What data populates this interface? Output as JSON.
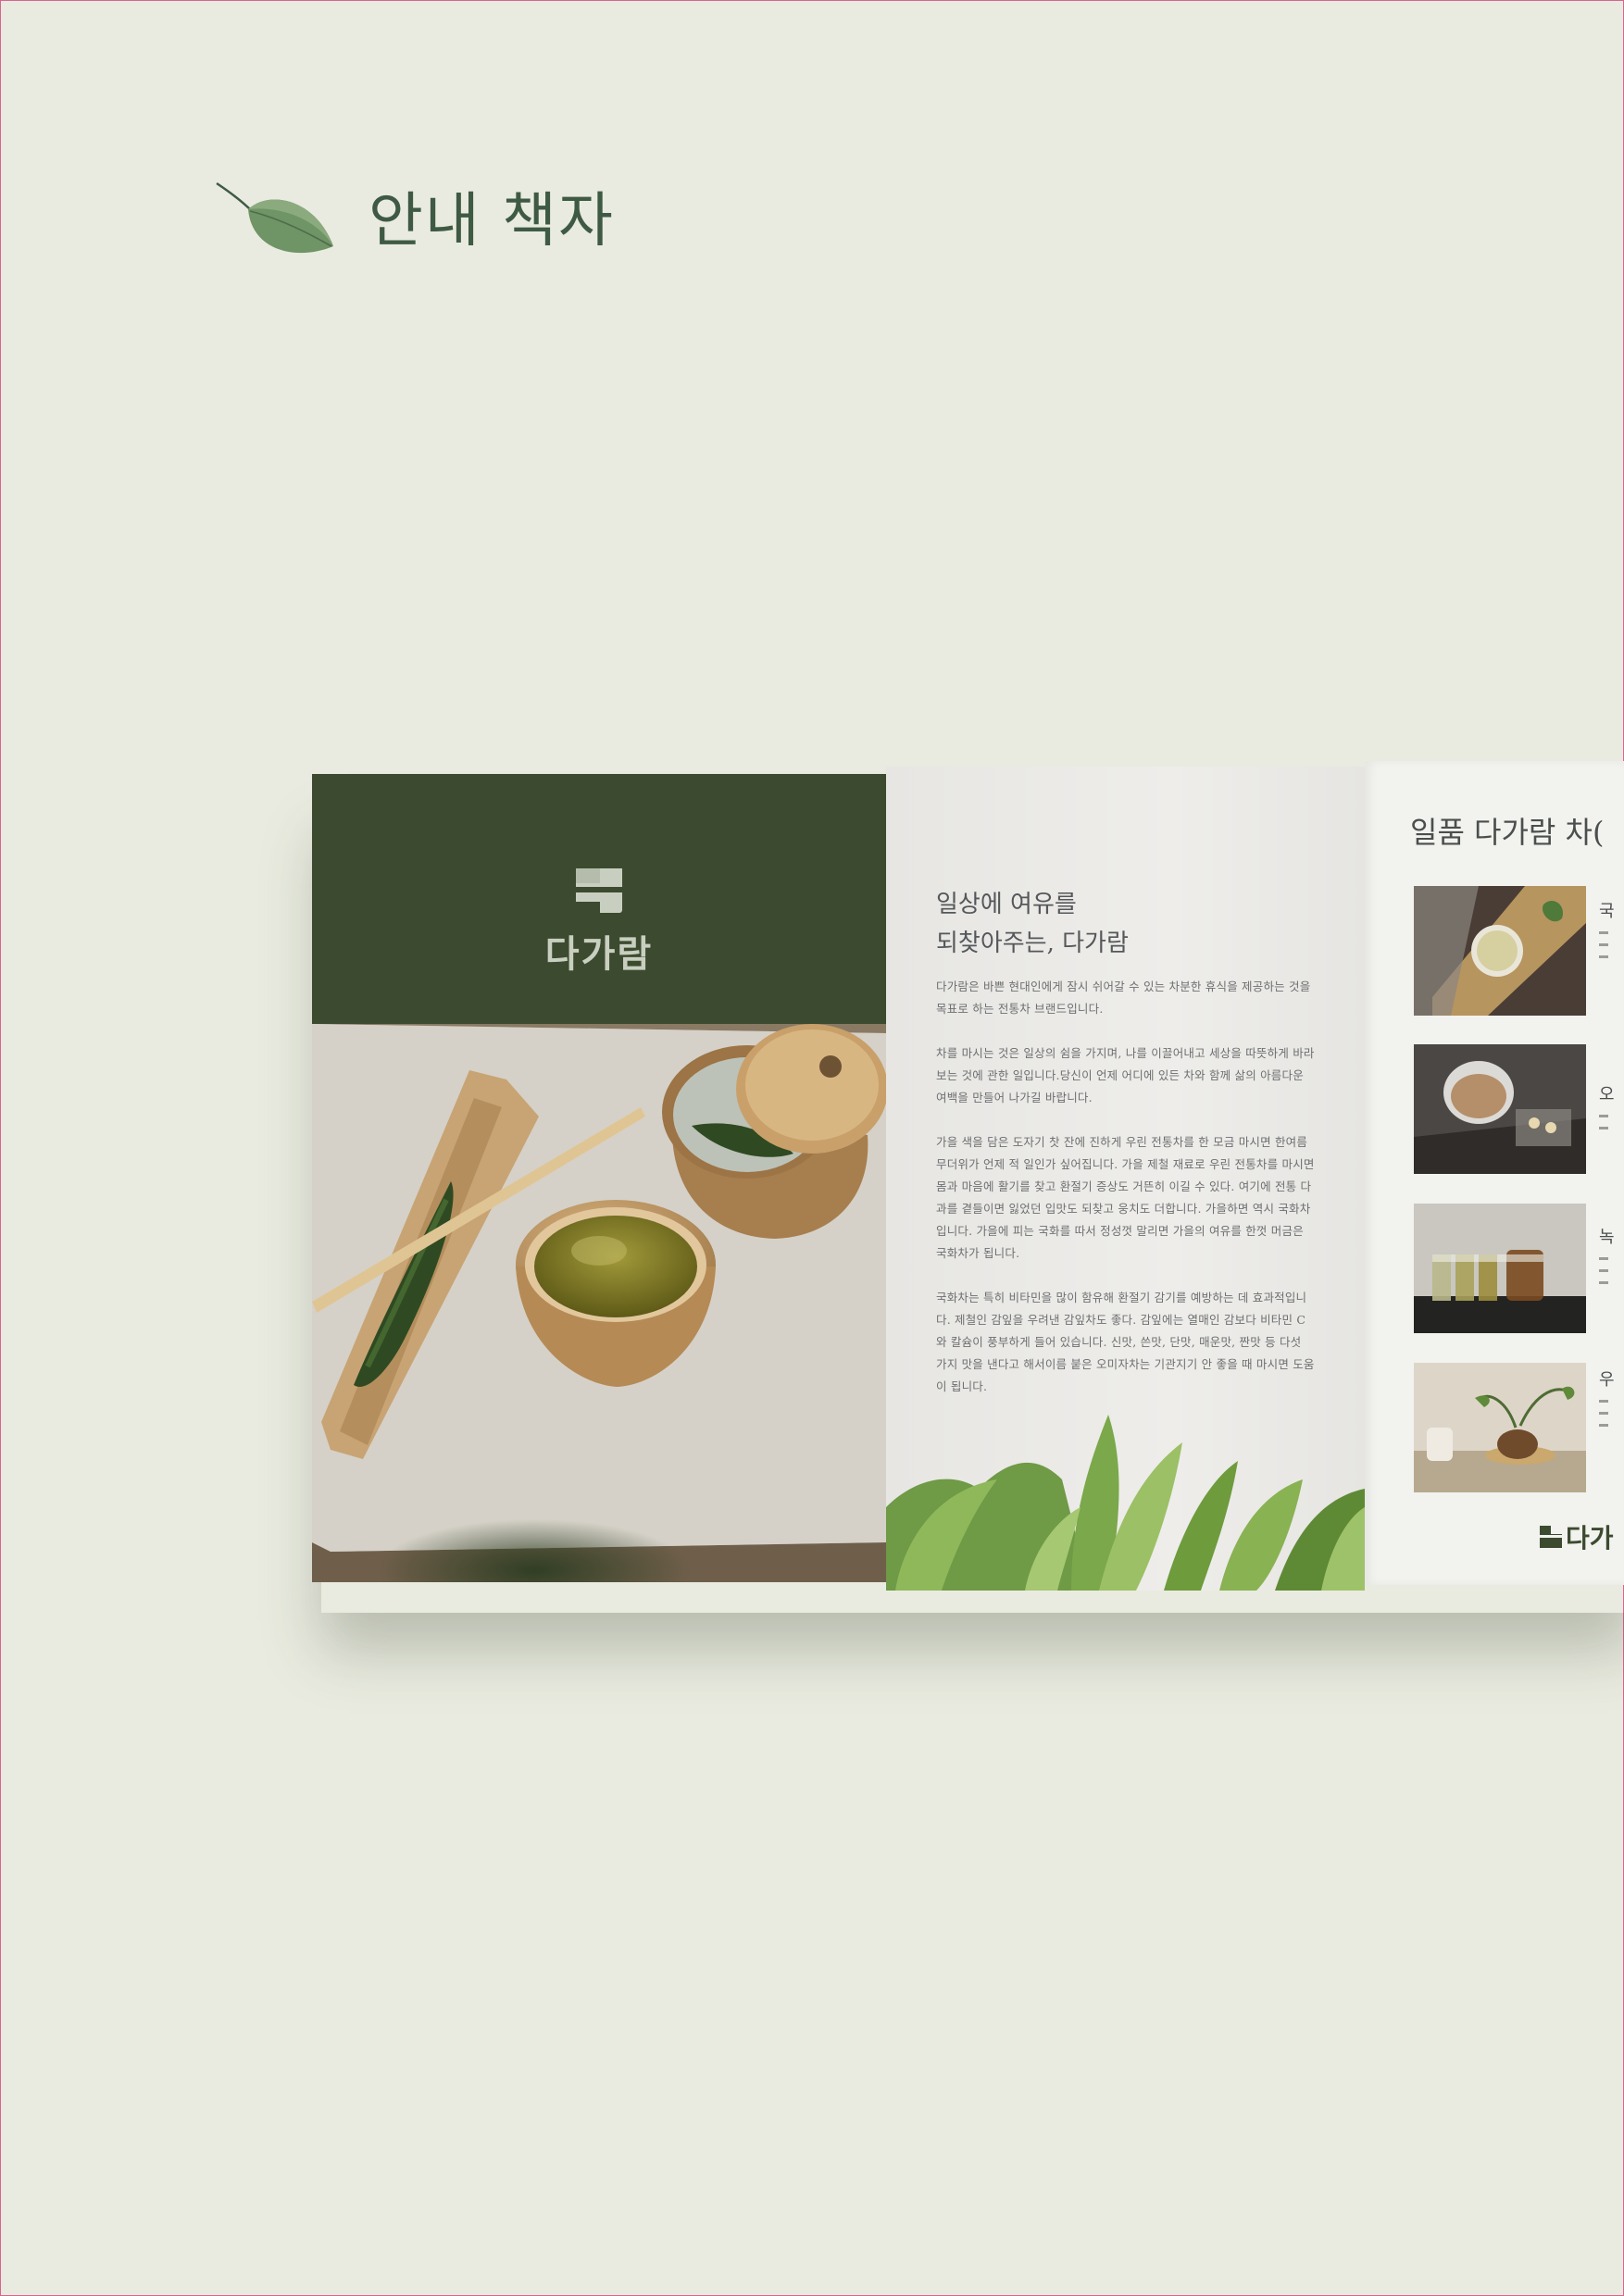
{
  "header": {
    "title": "안내 책자",
    "icon": "leaf-icon"
  },
  "brochure": {
    "left_panel": {
      "logo_text": "다가람",
      "logo_icon": "brand-mark-icon",
      "background_color": "#3c4b2f"
    },
    "middle_panel": {
      "heading_line_1": "일상에 여유를",
      "heading_line_2": "되찾아주는, 다가람",
      "paragraphs": [
        "다가람은 바쁜 현대인에게 잠시 쉬어갈 수 있는 차분한 휴식을 제공하는 것을 목표로 하는 전통차 브랜드입니다.",
        "차를 마시는 것은 일상의 쉼을 가지며, 나를 이끌어내고 세상을 따뜻하게 바라보는 것에 관한 일입니다.당신이 언제 어디에 있든 차와 함께 삶의 아름다운 여백을 만들어 나가길 바랍니다.",
        "가을 색을 담은 도자기 찻 잔에 진하게 우린 전통차를 한 모금 마시면 한여름 무더위가 언제 적 일인가 싶어집니다. 가을 제철 재료로 우린 전통차를 마시면 몸과 마음에 활기를 찾고 환절기 증상도 거뜬히 이길 수 있다. 여기에 전통 다과를 곁들이면 잃었던 입맛도 되찾고 웅치도 더합니다. 가을하면 역시 국화차입니다. 가을에 피는 국화를 따서 정성껏 말리면 가을의 여유를 한껏 머금은 국화차가 됩니다.",
        "국화차는 특히 비타민을 많이 함유해 환절기 감기를 예방하는 데 효과적입니다. 제철인 감잎을 우려낸 감잎차도 좋다. 감잎에는 열매인 감보다 비타민 C와 칼슘이 풍부하게 들어 있습니다. 신맛, 쓴맛, 단맛, 매운맛, 짠맛 등 다섯 가지 맛을 낸다고 해서이름 붙은 오미자차는 기관지기 안 좋을 때 마시면 도움이 됩니다."
      ]
    },
    "right_panel": {
      "title": "일품 다가람 차(",
      "products": [
        {
          "name_partial": "국",
          "icon": "chrysanthemum-tea-photo"
        },
        {
          "name_partial": "오",
          "icon": "omija-tea-photo"
        },
        {
          "name_partial": "녹",
          "icon": "green-tea-glasses-photo"
        },
        {
          "name_partial": "우",
          "icon": "teapot-plant-photo"
        }
      ],
      "logo_text": "다가"
    }
  },
  "colors": {
    "background": "#e9ebe0",
    "accent_dark_green": "#3c4b2f",
    "title_green": "#3f5a44",
    "border_pink": "#d8648f"
  }
}
